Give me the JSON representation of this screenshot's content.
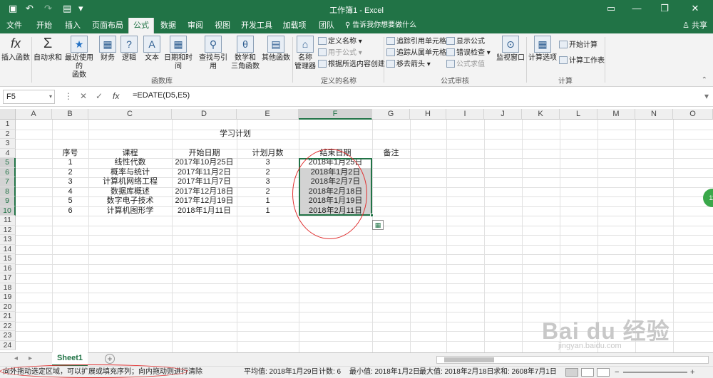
{
  "title_bar": {
    "title": "工作簿1 - Excel"
  },
  "tabs": [
    "文件",
    "开始",
    "插入",
    "页面布局",
    "公式",
    "数据",
    "审阅",
    "视图",
    "开发工具",
    "加载项",
    "团队"
  ],
  "active_tab": "公式",
  "search_text": "告诉我你想要做什么",
  "share_label": "共享",
  "ribbon": {
    "insert_fn": "插入函数",
    "lib_buttons": [
      "自动求和",
      "最近使用的\n函数",
      "财务",
      "逻辑",
      "文本",
      "日期和时间",
      "查找与引用",
      "数学和\n三角函数",
      "其他函数"
    ],
    "lib_group": "函数库",
    "name_mgr": "名称\n管理器",
    "names_items": [
      "定义名称",
      "用于公式",
      "根据所选内容创建"
    ],
    "names_group": "定义的名称",
    "audit_items": [
      "追踪引用单元格",
      "追踪从属单元格",
      "移去箭头",
      "显示公式",
      "错误检查",
      "公式求值"
    ],
    "audit_group": "公式审核",
    "watch": "监视窗口",
    "calc_options": "计算选项",
    "calc_items": [
      "开始计算",
      "计算工作表"
    ],
    "calc_group": "计算"
  },
  "formula_bar": {
    "namebox": "F5",
    "formula": "=EDATE(D5,E5)"
  },
  "columns": [
    "A",
    "B",
    "C",
    "D",
    "E",
    "F",
    "G",
    "H",
    "I",
    "J",
    "K",
    "L",
    "M",
    "N",
    "O"
  ],
  "selected_column": "F",
  "rows": [
    "1",
    "2",
    "3",
    "4",
    "5",
    "6",
    "7",
    "8",
    "9",
    "10",
    "11",
    "12",
    "13",
    "14",
    "15",
    "16",
    "17",
    "18",
    "19",
    "20",
    "21",
    "22",
    "23",
    "24"
  ],
  "selected_rows": [
    "5",
    "6",
    "7",
    "8",
    "9",
    "10"
  ],
  "sheet": {
    "title": "学习计划",
    "headers": [
      "序号",
      "课程",
      "开始日期",
      "计划月数",
      "结束日期",
      "备注"
    ],
    "data": [
      [
        "1",
        "线性代数",
        "2017年10月25日",
        "3",
        "2018年1月25日"
      ],
      [
        "2",
        "概率与统计",
        "2017年11月2日",
        "2",
        "2018年1月2日"
      ],
      [
        "3",
        "计算机网络工程",
        "2017年11月7日",
        "3",
        "2018年2月7日"
      ],
      [
        "4",
        "数据库概述",
        "2017年12月18日",
        "2",
        "2018年2月18日"
      ],
      [
        "5",
        "数字电子技术",
        "2017年12月19日",
        "1",
        "2018年1月19日"
      ],
      [
        "6",
        "计算机图形学",
        "2018年1月11日",
        "1",
        "2018年2月11日"
      ]
    ]
  },
  "sheet_tab": "Sheet1",
  "status": {
    "message": "向外拖动选定区域，可以扩展或填充序列；向内拖动则进行清除",
    "average": "平均值: 2018年1月29日",
    "count": "计数: 6",
    "min": "最小值: 2018年1月2日",
    "max": "最大值: 2018年2月18日",
    "sum": "求和: 2608年7月1日"
  },
  "watermark": "Bai du 经验",
  "watermark_url": "jingyan.baidu.com"
}
